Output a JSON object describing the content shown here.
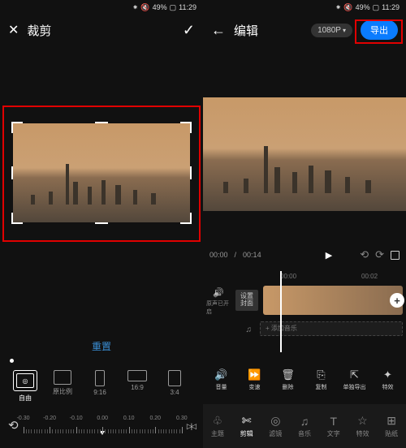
{
  "status": {
    "bt": "⁕",
    "mute": "🔇",
    "battery_pct": "49%",
    "batt_icon": "▢",
    "time": "11:29"
  },
  "left": {
    "title": "裁剪",
    "reset": "重置",
    "ratios": [
      {
        "key": "free",
        "label": "自由"
      },
      {
        "key": "orig",
        "label": "原比例"
      },
      {
        "key": "916",
        "label": "9:16"
      },
      {
        "key": "169",
        "label": "16:9"
      },
      {
        "key": "34",
        "label": "3:4"
      }
    ],
    "ruler_labels": [
      "-0.30",
      "-0.20",
      "-0.10",
      "0.00",
      "0.10",
      "0.20",
      "0.30"
    ]
  },
  "right": {
    "title": "编辑",
    "resolution": "1080P",
    "export": "导出",
    "time_current": "00:00",
    "time_total": "00:14",
    "timestamps": [
      "00:00",
      "00:02"
    ],
    "mute_label": "原声已开启",
    "cover_btn": "设置封面",
    "add_audio": "+ 添加音乐",
    "tools": [
      {
        "icon": "🔊",
        "label": "音量"
      },
      {
        "icon": "⏩",
        "label": "变速"
      },
      {
        "icon": "🗑",
        "label": "删除"
      },
      {
        "icon": "⎘",
        "label": "复制"
      },
      {
        "icon": "⇱",
        "label": "单独导出"
      },
      {
        "icon": "✦",
        "label": "特效"
      }
    ],
    "tabs": [
      {
        "icon": "♧",
        "label": "主题"
      },
      {
        "icon": "✄",
        "label": "剪辑",
        "active": true
      },
      {
        "icon": "◎",
        "label": "滤镜"
      },
      {
        "icon": "♫",
        "label": "音乐"
      },
      {
        "icon": "T",
        "label": "文字"
      },
      {
        "icon": "☆",
        "label": "特效"
      },
      {
        "icon": "⊞",
        "label": "贴纸"
      }
    ]
  }
}
